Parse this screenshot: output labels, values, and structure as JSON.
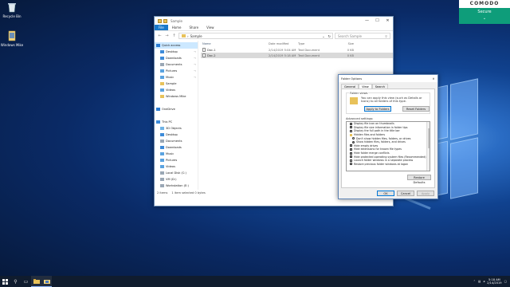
{
  "desktop": {
    "icons": [
      {
        "label": "Recycle Bin",
        "icon": "recycle-bin-icon"
      },
      {
        "label": "Windows Mike",
        "icon": "folder-icon"
      }
    ]
  },
  "comodo": {
    "brand": "COMODO",
    "status": "Secure",
    "toggle": "⌄"
  },
  "explorer": {
    "title": "Sample",
    "quick_access_toolbar": [
      "properties-icon",
      "new-folder-icon"
    ],
    "window_controls": {
      "minimize": "—",
      "maximize": "☐",
      "close": "✕"
    },
    "ribbon_tabs": [
      "File",
      "Home",
      "Share",
      "View"
    ],
    "address": {
      "back": "←",
      "forward": "→",
      "up": "↑",
      "path_prefix": "›",
      "path": "Sample",
      "dropdown": "⌄",
      "refresh": "↻"
    },
    "search": {
      "placeholder": "Search Sample",
      "icon": "search-icon"
    },
    "nav_items": [
      {
        "label": "Quick access",
        "icon": "star-icon",
        "selected": true,
        "pinned": false,
        "indent": 0
      },
      {
        "label": "Desktop",
        "icon": "desktop-icon",
        "pinned": true,
        "indent": 1
      },
      {
        "label": "Downloads",
        "icon": "download-icon",
        "pinned": true,
        "indent": 1
      },
      {
        "label": "Documents",
        "icon": "documents-icon",
        "pinned": true,
        "indent": 1
      },
      {
        "label": "Pictures",
        "icon": "pictures-icon",
        "pinned": true,
        "indent": 1
      },
      {
        "label": "Music",
        "icon": "music-icon",
        "pinned": true,
        "indent": 1
      },
      {
        "label": "Sample",
        "icon": "folder-icon",
        "pinned": false,
        "indent": 1
      },
      {
        "label": "Videos",
        "icon": "videos-icon",
        "pinned": false,
        "indent": 1
      },
      {
        "label": "Windows Mike",
        "icon": "folder-icon",
        "pinned": false,
        "indent": 1
      },
      {
        "label": "",
        "icon": "",
        "pinned": false,
        "indent": 0
      },
      {
        "label": "OneDrive",
        "icon": "cloud-icon",
        "pinned": false,
        "indent": 0
      },
      {
        "label": "",
        "icon": "",
        "pinned": false,
        "indent": 0
      },
      {
        "label": "This PC",
        "icon": "computer-icon",
        "pinned": false,
        "indent": 0
      },
      {
        "label": "3D Objects",
        "icon": "cube-icon",
        "pinned": false,
        "indent": 1
      },
      {
        "label": "Desktop",
        "icon": "desktop-icon",
        "pinned": false,
        "indent": 1
      },
      {
        "label": "Documents",
        "icon": "documents-icon",
        "pinned": false,
        "indent": 1
      },
      {
        "label": "Downloads",
        "icon": "download-icon",
        "pinned": false,
        "indent": 1
      },
      {
        "label": "Music",
        "icon": "music-icon",
        "pinned": false,
        "indent": 1
      },
      {
        "label": "Pictures",
        "icon": "pictures-icon",
        "pinned": false,
        "indent": 1
      },
      {
        "label": "Videos",
        "icon": "videos-icon",
        "pinned": false,
        "indent": 1
      },
      {
        "label": "Local Disk (C:)",
        "icon": "drive-icon",
        "pinned": false,
        "indent": 1
      },
      {
        "label": "VM (D:)",
        "icon": "drive-icon",
        "pinned": false,
        "indent": 1
      },
      {
        "label": "Workstation (E:)",
        "icon": "drive-icon",
        "pinned": false,
        "indent": 1
      },
      {
        "label": "Media (F:)",
        "icon": "drive-icon",
        "pinned": false,
        "indent": 1
      },
      {
        "label": "New Volume (G:)",
        "icon": "drive-icon",
        "pinned": false,
        "indent": 1
      },
      {
        "label": "Setups (H:)",
        "icon": "drive-icon",
        "pinned": false,
        "indent": 1
      }
    ],
    "columns": {
      "name": "Name",
      "date": "Date modified",
      "type": "Type",
      "size": "Size"
    },
    "files": [
      {
        "name": "Doc-1",
        "date": "2/14/2019 5:04 AM",
        "type": "Text Document",
        "size": "0 KB",
        "selected": false
      },
      {
        "name": "Doc-2",
        "date": "2/14/2019 5:18 AM",
        "type": "Text Document",
        "size": "0 KB",
        "selected": true
      }
    ],
    "status": {
      "items": "2 items",
      "selected": "1 item selected 0 bytes"
    }
  },
  "folder_options": {
    "title": "Folder Options",
    "close": "✕",
    "tabs": [
      "General",
      "View",
      "Search"
    ],
    "active_tab": "View",
    "folder_views_label": "Folder views",
    "folder_views_desc": "You can apply this view (such as Details or Icons) to all folders of this type.",
    "apply_button": "Apply to Folders",
    "reset_button": "Reset Folders",
    "advanced_label": "Advanced settings:",
    "advanced_items": [
      {
        "label": "Display file icon on thumbnails",
        "kind": "checkbox",
        "checked": true,
        "indent": 1
      },
      {
        "label": "Display file size information in folder tips",
        "kind": "checkbox",
        "checked": true,
        "indent": 1
      },
      {
        "label": "Display the full path in the title bar",
        "kind": "checkbox",
        "checked": false,
        "indent": 1
      },
      {
        "label": "Hidden files and folders",
        "kind": "folder",
        "checked": false,
        "indent": 1
      },
      {
        "label": "Don't show hidden files, folders, or drives",
        "kind": "radio",
        "checked": false,
        "indent": 2
      },
      {
        "label": "Show hidden files, folders, and drives",
        "kind": "radio",
        "checked": true,
        "indent": 2
      },
      {
        "label": "Hide empty drives",
        "kind": "checkbox",
        "checked": true,
        "indent": 1
      },
      {
        "label": "Hide extensions for known file types",
        "kind": "checkbox",
        "checked": true,
        "indent": 1
      },
      {
        "label": "Hide folder merge conflicts",
        "kind": "checkbox",
        "checked": true,
        "indent": 1
      },
      {
        "label": "Hide protected operating system files (Recommended)",
        "kind": "checkbox",
        "checked": true,
        "indent": 1
      },
      {
        "label": "Launch folder windows in a separate process",
        "kind": "checkbox",
        "checked": false,
        "indent": 1
      },
      {
        "label": "Restore previous folder windows at logon",
        "kind": "checkbox",
        "checked": false,
        "indent": 1
      }
    ],
    "restore_defaults": "Restore Defaults",
    "ok": "OK",
    "cancel": "Cancel",
    "apply": "Apply"
  },
  "taskbar": {
    "start_icon": "windows-start-icon",
    "search_icon": "search-icon",
    "task_view_icon": "task-view-icon",
    "apps": [
      {
        "icon": "file-explorer-icon",
        "active": true
      },
      {
        "icon": "folder-options-icon",
        "active": true
      }
    ],
    "tray_icons": [
      "chevron-up-icon",
      "network-icon",
      "volume-icon"
    ],
    "time": "5:18 AM",
    "date": "2/14/2019",
    "notifications": "notification-icon"
  }
}
